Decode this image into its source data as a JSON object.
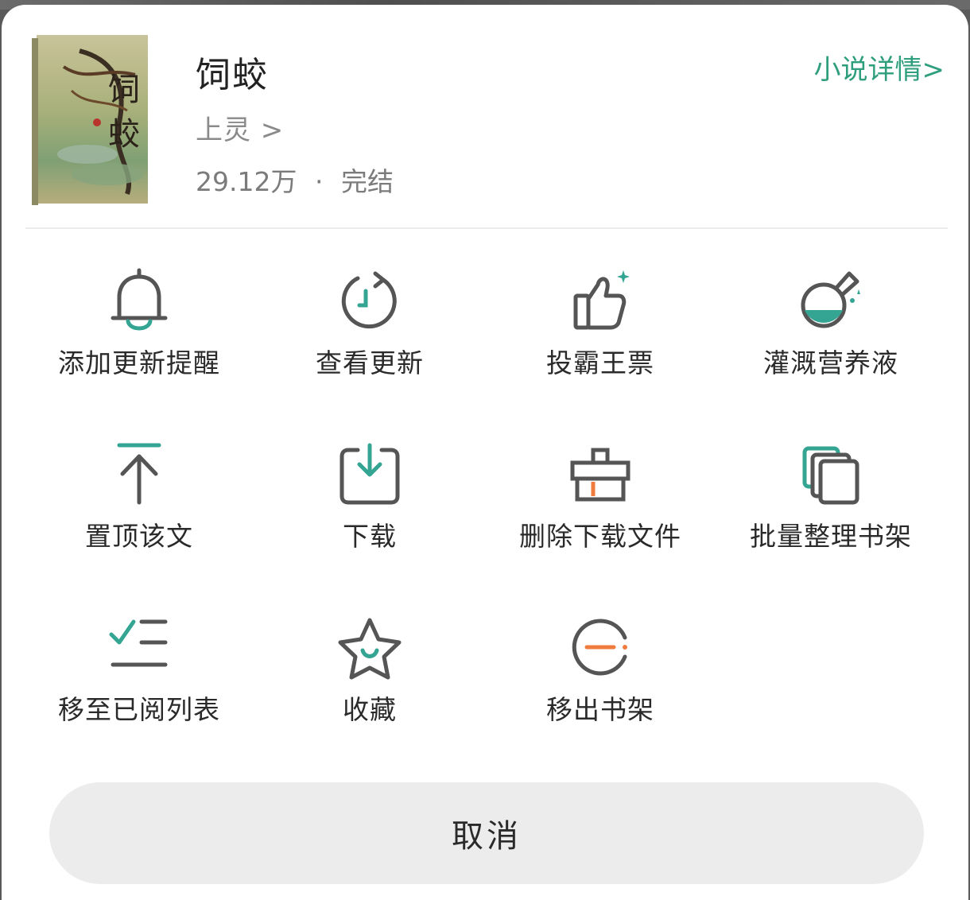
{
  "book": {
    "title": "饲蛟",
    "author": "上灵 >",
    "word_count": "29.12万",
    "separator": "·",
    "status": "完结",
    "detail_link": "小说详情>",
    "cover_image": "book-cover-illustration"
  },
  "colors": {
    "accent": "#2e9e7d",
    "teal": "#35a593",
    "orange": "#ef7b3d",
    "icon_stroke": "#555555",
    "cancel_bg": "#ececec"
  },
  "actions": [
    {
      "label": "添加更新提醒",
      "icon": "bell-icon"
    },
    {
      "label": "查看更新",
      "icon": "refresh-clock-icon"
    },
    {
      "label": "投霸王票",
      "icon": "thumbs-up-icon"
    },
    {
      "label": "灌溉营养液",
      "icon": "flask-icon"
    },
    {
      "label": "置顶该文",
      "icon": "pin-to-top-icon"
    },
    {
      "label": "下载",
      "icon": "download-icon"
    },
    {
      "label": "删除下载文件",
      "icon": "delete-box-icon"
    },
    {
      "label": "批量整理书架",
      "icon": "stack-icon"
    },
    {
      "label": "移至已阅列表",
      "icon": "checklist-icon"
    },
    {
      "label": "收藏",
      "icon": "star-icon"
    },
    {
      "label": "移出书架",
      "icon": "remove-circle-icon"
    }
  ],
  "cancel_label": "取消"
}
